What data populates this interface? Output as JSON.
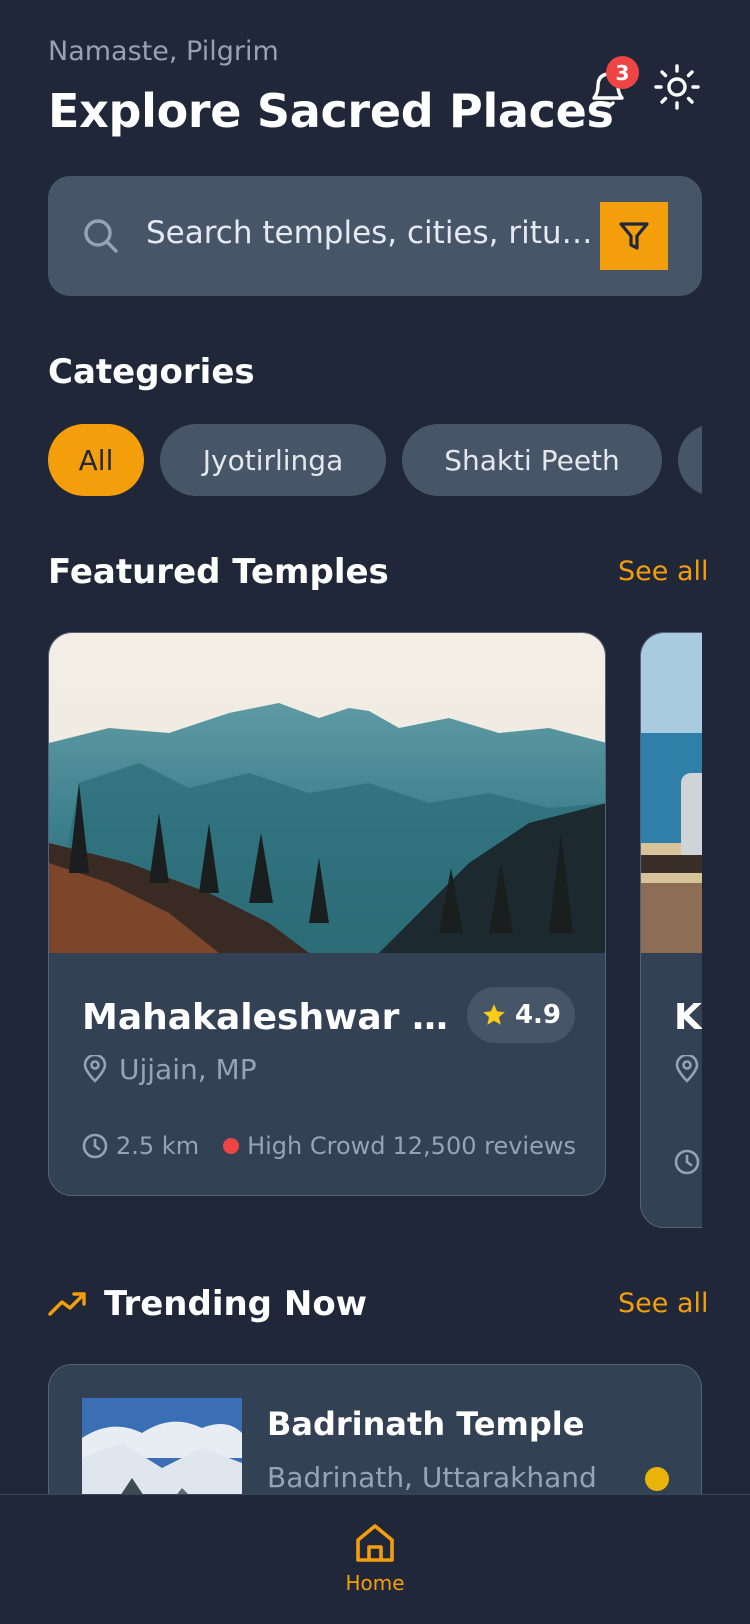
{
  "header": {
    "greeting": "Namaste, Pilgrim",
    "title": "Explore Sacred Places",
    "notification_count": "3"
  },
  "search": {
    "placeholder": "Search temples, cities, rituals..."
  },
  "categories": {
    "title": "Categories",
    "items": [
      {
        "label": "All",
        "active": true
      },
      {
        "label": "Jyotirlinga",
        "active": false
      },
      {
        "label": "Shakti Peeth",
        "active": false
      }
    ]
  },
  "featured": {
    "title": "Featured Temples",
    "see_all": "See all",
    "cards": [
      {
        "name": "Mahakaleshwar Temple",
        "rating": "4.9",
        "location": "Ujjain, MP",
        "distance": "2.5 km",
        "crowd": "High Crowd",
        "reviews": "12,500 reviews"
      },
      {
        "name": "Ka"
      }
    ]
  },
  "trending": {
    "title": "Trending Now",
    "see_all": "See all",
    "items": [
      {
        "name": "Badrinath Temple",
        "location": "Badrinath, Uttarakhand"
      }
    ]
  },
  "nav": {
    "home": "Home"
  },
  "colors": {
    "accent": "#f59e0b",
    "background": "#1f2739",
    "card": "#334155",
    "crowd_high": "#ef4444",
    "trend_status": "#eab308"
  }
}
